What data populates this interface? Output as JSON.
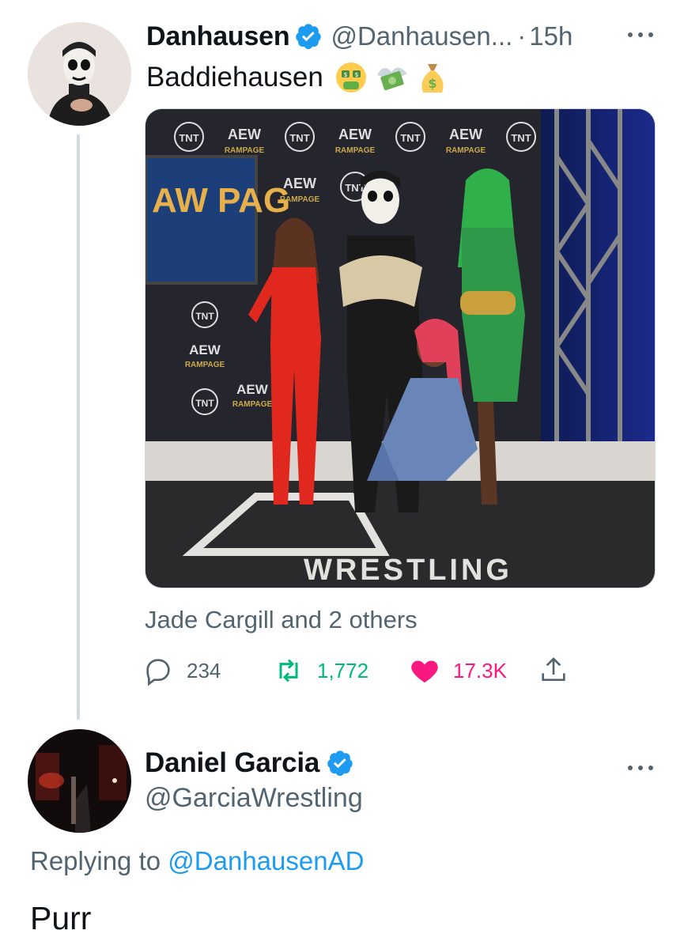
{
  "tweet": {
    "author_name": "Danhausen",
    "author_handle": "@Danhausen...",
    "dot": "·",
    "time": "15h",
    "more_icon": "more-horizontal-icon",
    "text": "Baddiehausen",
    "emojis": [
      "money-mouth-face-icon",
      "money-with-wings-icon",
      "money-bag-icon"
    ],
    "media_sign_tnt": "TNT",
    "media_sign_aew": "AEW",
    "media_sign_rampage": "RAMPAGE",
    "media_floor_text": "WRESTLING",
    "media_screen_text": "AW PAG",
    "tagged": "Jade Cargill and 2 others",
    "actions": {
      "reply_count": "234",
      "retweet_count": "1,772",
      "like_count": "17.3K"
    }
  },
  "reply": {
    "author_name": "Daniel Garcia",
    "author_handle": "@GarciaWrestling",
    "replying_prefix": "Replying to",
    "replying_handle": "@DanhausenAD",
    "text": "Purr"
  },
  "colors": {
    "verified": "#1d9bf0",
    "retweet": "#00ba7c",
    "like": "#f91880",
    "secondary_text": "#536471",
    "link": "#1d9bf0"
  }
}
